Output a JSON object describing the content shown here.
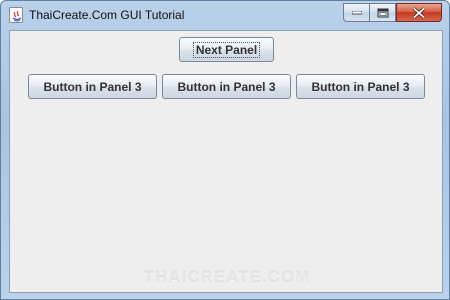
{
  "window": {
    "title": "ThaiCreate.Com GUI Tutorial"
  },
  "icons": {
    "app": "java-app-icon",
    "minimize": "minimize-icon",
    "maximize": "maximize-icon",
    "close": "close-icon"
  },
  "panel": {
    "next_button": "Next Panel",
    "buttons": [
      "Button in Panel 3",
      "Button in Panel 3",
      "Button in Panel 3"
    ]
  },
  "watermark": "THAICREATE.COM",
  "colors": {
    "client_bg": "#eeeeee",
    "close_red": "#c7371f",
    "titlebar": "#b9d1ea"
  }
}
